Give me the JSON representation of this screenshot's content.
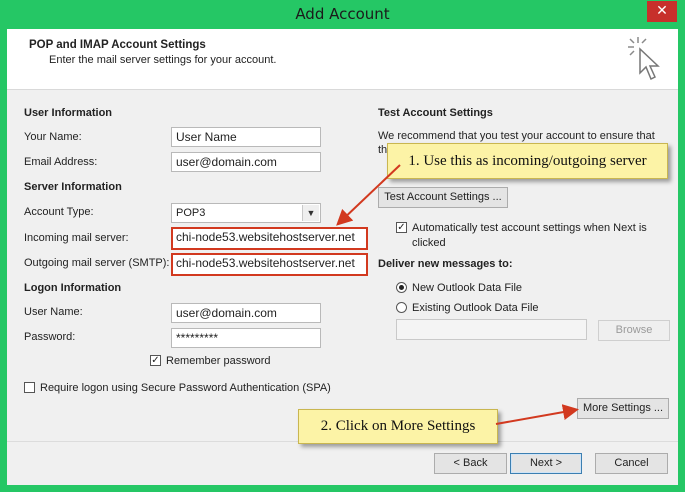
{
  "window": {
    "title": "Add Account",
    "close_glyph": "✕"
  },
  "header": {
    "title": "POP and IMAP Account Settings",
    "subtitle": "Enter the mail server settings for your account.",
    "icon": "wizard-cursor-icon"
  },
  "user_info": {
    "heading": "User Information",
    "name_label": "Your Name:",
    "name_value": "User Name",
    "email_label": "Email Address:",
    "email_value": "user@domain.com"
  },
  "server_info": {
    "heading": "Server Information",
    "account_type_label": "Account Type:",
    "account_type_value": "POP3",
    "incoming_label": "Incoming mail server:",
    "incoming_value": "chi-node53.websitehostserver.net",
    "outgoing_label": "Outgoing mail server (SMTP):",
    "outgoing_value": "chi-node53.websitehostserver.net"
  },
  "logon_info": {
    "heading": "Logon Information",
    "username_label": "User Name:",
    "username_value": "user@domain.com",
    "password_label": "Password:",
    "password_value": "*********",
    "remember_label": "Remember password",
    "remember_checked": true,
    "spa_label": "Require logon using Secure Password Authentication (SPA)",
    "spa_checked": false
  },
  "test_settings": {
    "heading": "Test Account Settings",
    "description_1": "We recommend that you test your account to ensure that",
    "description_2": "th",
    "test_button": "Test Account Settings ...",
    "auto_test_label_1": "Automatically test account settings when Next is",
    "auto_test_label_2": "clicked",
    "auto_test_checked": true
  },
  "deliver": {
    "heading": "Deliver new messages to:",
    "option_new": "New Outlook Data File",
    "option_existing": "Existing Outlook Data File",
    "browse_button": "Browse"
  },
  "more_settings_button": "More Settings ...",
  "footer": {
    "back_button": "< Back",
    "next_button": "Next >",
    "cancel_button": "Cancel"
  },
  "annotations": {
    "callout_1": "1. Use this as incoming/outgoing server",
    "callout_2": "2. Click on More Settings",
    "highlight_color": "#d2391f",
    "callout_color": "#fcf3a6"
  },
  "colors": {
    "window_frame": "#25c765",
    "close_button": "#c7302b"
  }
}
